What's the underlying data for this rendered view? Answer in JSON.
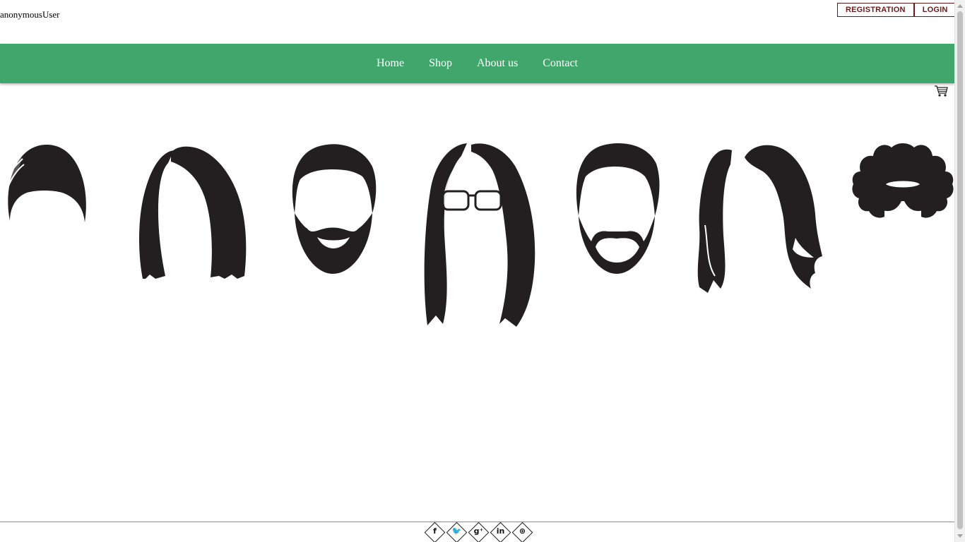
{
  "user": {
    "name": "anonymousUser"
  },
  "auth": {
    "registration_label": "REGISTRATION",
    "login_label": "LOGIN"
  },
  "nav": {
    "items": [
      {
        "label": "Home"
      },
      {
        "label": "Shop"
      },
      {
        "label": "About us"
      },
      {
        "label": "Contact"
      }
    ]
  },
  "cart": {
    "icon": "shopping-cart-icon"
  },
  "hero": {
    "icons": [
      "beanie-hair-icon",
      "long-hair-icon",
      "full-beard-icon",
      "long-hair-glasses-icon",
      "goatee-icon",
      "wavy-hair-icon",
      "curly-hair-sunglasses-icon"
    ]
  },
  "social": {
    "items": [
      {
        "icon": "facebook-icon",
        "glyph": "f"
      },
      {
        "icon": "twitter-icon",
        "glyph": "🐦"
      },
      {
        "icon": "google-plus-icon",
        "glyph": "g⁺"
      },
      {
        "icon": "linkedin-icon",
        "glyph": "in"
      },
      {
        "icon": "dribbble-icon",
        "glyph": "⊛"
      }
    ]
  },
  "colors": {
    "nav_bg": "#40a66b",
    "button_border": "#6b1a1a",
    "silhouette": "#231f20"
  }
}
